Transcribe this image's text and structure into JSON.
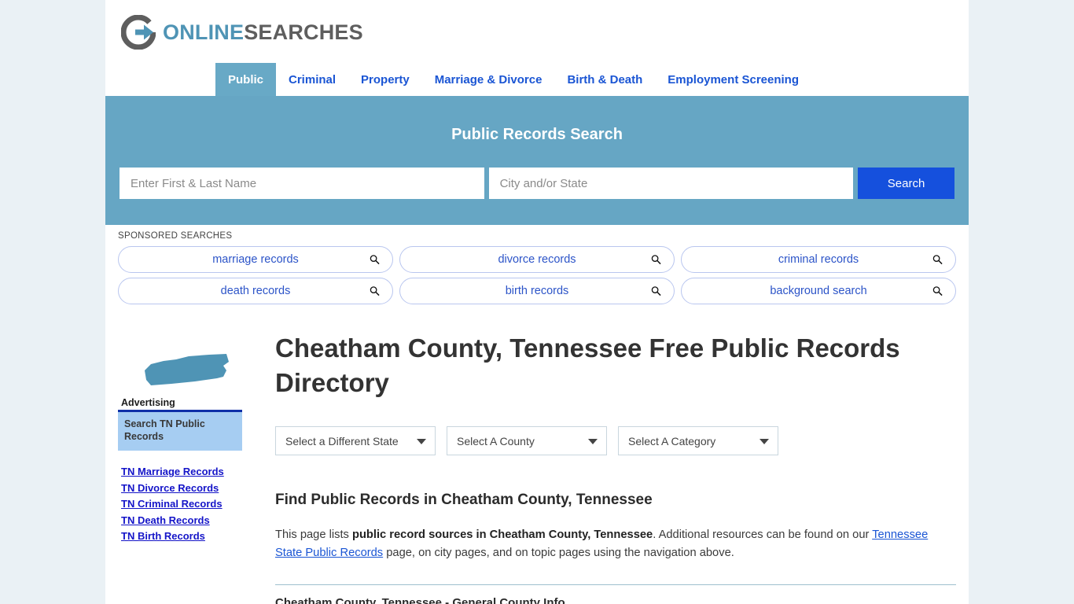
{
  "brand": {
    "name_part1": "ONLINE",
    "name_part2": "SEARCHES",
    "logo_icon": "circle-arrow-right-icon",
    "accent_blue": "#4f94b5",
    "accent_gray": "#5e5e5e"
  },
  "nav": {
    "items": [
      {
        "label": "Public",
        "active": true
      },
      {
        "label": "Criminal",
        "active": false
      },
      {
        "label": "Property",
        "active": false
      },
      {
        "label": "Marriage & Divorce",
        "active": false
      },
      {
        "label": "Birth & Death",
        "active": false
      },
      {
        "label": "Employment Screening",
        "active": false
      }
    ],
    "active_bg": "#68a9c6",
    "link_color": "#1a55d4"
  },
  "search": {
    "title": "Public Records Search",
    "name_placeholder": "Enter First & Last Name",
    "name_value": "",
    "city_placeholder": "City and/or State",
    "city_value": "",
    "button_label": "Search",
    "banner_bg": "#66a6c4",
    "button_bg": "#1550dd"
  },
  "sponsored": {
    "label": "SPONSORED SEARCHES",
    "pills": [
      {
        "label": "marriage records",
        "icon": "search-icon"
      },
      {
        "label": "divorce records",
        "icon": "search-icon"
      },
      {
        "label": "criminal records",
        "icon": "search-icon"
      },
      {
        "label": "death records",
        "icon": "search-icon"
      },
      {
        "label": "birth records",
        "icon": "search-icon"
      },
      {
        "label": "background search",
        "icon": "search-icon"
      }
    ]
  },
  "page": {
    "state_thumb_icon": "tennessee-state-map-icon",
    "title": "Cheatham County, Tennessee Free Public Records Directory",
    "selects": [
      {
        "label": "Select a Different State",
        "caret": "chevron-down-icon"
      },
      {
        "label": "Select A County",
        "caret": "chevron-down-icon"
      },
      {
        "label": "Select A Category",
        "caret": "chevron-down-icon"
      }
    ],
    "section_heading": "Find Public Records in Cheatham County, Tennessee",
    "paragraph": {
      "lead": "This page lists ",
      "bold": "public record sources in Cheatham County, Tennessee",
      "mid": ". Additional resources can be found on our ",
      "link": "Tennessee State Public Records",
      "tail": " page, on city pages, and on topic pages using the navigation above."
    },
    "table_heading": "Cheatham County, Tennessee - General County Info"
  },
  "sidebar": {
    "advertising_label": "Advertising",
    "ad_box_text": "Search TN Public Records",
    "links": [
      "TN Marriage Records",
      "TN Divorce Records",
      "TN Criminal Records",
      "TN Death Records",
      "TN Birth Records"
    ]
  }
}
